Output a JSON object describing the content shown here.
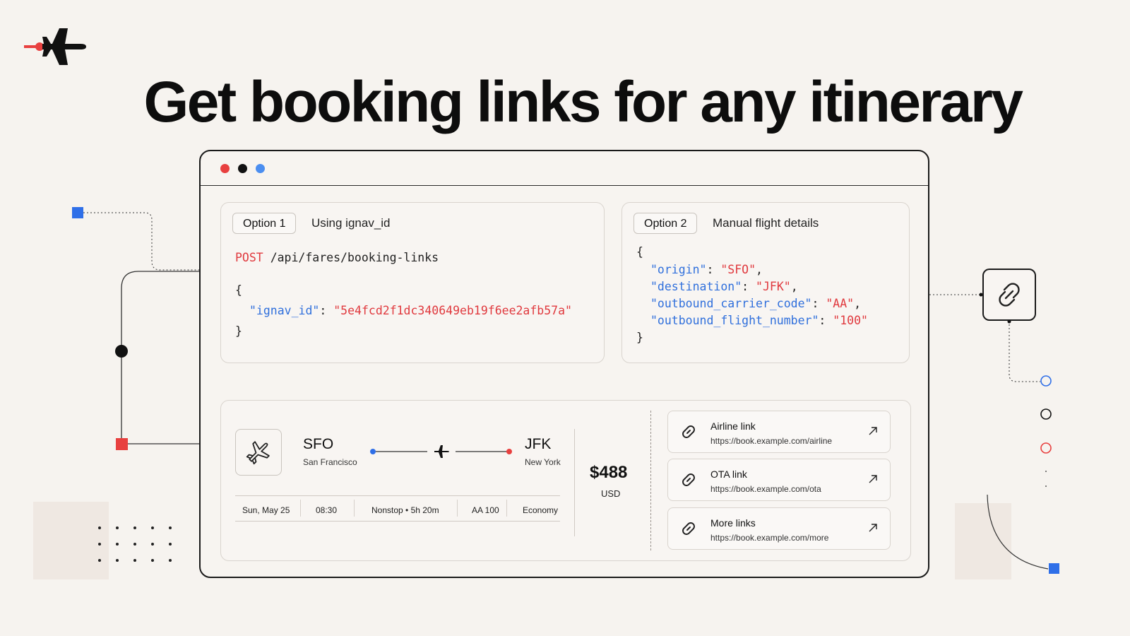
{
  "hero": {
    "title": "Get booking links for any itinerary"
  },
  "option1": {
    "badge": "Option 1",
    "label": "Using ignav_id",
    "method": "POST",
    "path": "/api/fares/booking-links",
    "open_brace": "{",
    "key": "\"ignav_id\"",
    "value": "\"5e4fcd2f1dc340649eb19f6ee2afb57a\"",
    "close_brace": "}"
  },
  "option2": {
    "badge": "Option 2",
    "label": "Manual flight details",
    "open_brace": "{",
    "close_brace": "}",
    "fields": [
      {
        "key": "\"origin\"",
        "value": "\"SFO\""
      },
      {
        "key": "\"destination\"",
        "value": "\"JFK\""
      },
      {
        "key": "\"outbound_carrier_code\"",
        "value": "\"AA\""
      },
      {
        "key": "\"outbound_flight_number\"",
        "value": "\"100\""
      }
    ]
  },
  "flight": {
    "origin_code": "SFO",
    "origin_city": "San Francisco",
    "dest_code": "JFK",
    "dest_city": "New York",
    "date": "Sun, May 25",
    "time": "08:30",
    "stops": "Nonstop • 5h 20m",
    "flight_no": "AA 100",
    "cabin": "Economy",
    "price": "$488",
    "currency": "USD"
  },
  "links": [
    {
      "title": "Airline link",
      "url": "https://book.example.com/airline"
    },
    {
      "title": "OTA link",
      "url": "https://book.example.com/ota"
    },
    {
      "title": "More links",
      "url": "https://book.example.com/more"
    }
  ],
  "colors": {
    "red": "#e8403f",
    "blue": "#2f6fe8",
    "key_blue": "#2f6fdc",
    "string_red": "#e0393e",
    "background": "#f6f3ef"
  },
  "icons": [
    "airplane-logo-icon",
    "airplane-icon",
    "link-icon",
    "external-arrow-icon",
    "chain-link-icon"
  ]
}
